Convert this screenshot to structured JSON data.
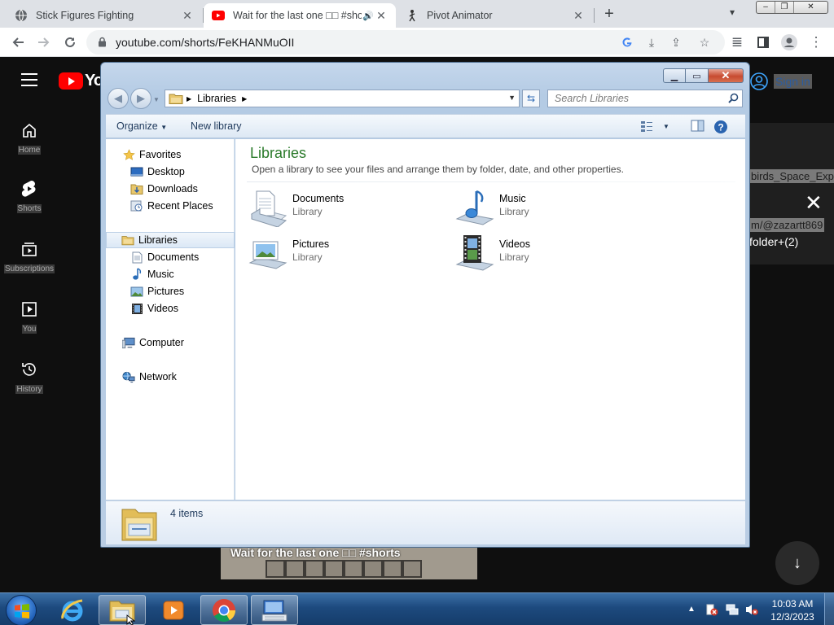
{
  "browser": {
    "tabs": [
      {
        "title": "Stick Figures Fighting",
        "active": false
      },
      {
        "title": "Wait for the last one □□ #shorts",
        "active": true,
        "audio": true
      },
      {
        "title": "Pivot Animator",
        "active": false
      }
    ],
    "url": "youtube.com/shorts/FeKHANMuOII"
  },
  "youtube": {
    "logo": "Yo",
    "nav": [
      {
        "label": "Home",
        "icon": "home-icon"
      },
      {
        "label": "Shorts",
        "icon": "shorts-icon"
      },
      {
        "label": "Subscriptions",
        "icon": "subscriptions-icon"
      },
      {
        "label": "You",
        "icon": "you-icon"
      },
      {
        "label": "History",
        "icon": "history-icon"
      }
    ],
    "sign_in": "Sign in",
    "panel_text_1": "birds_Space_Exp",
    "panel_text_2": "m/@zazartt869",
    "panel_text_3": "folder+(2)",
    "video_title": "Wait for the last one □□ #shorts"
  },
  "explorer": {
    "breadcrumb": "Libraries",
    "search_placeholder": "Search Libraries",
    "commands": {
      "organize": "Organize",
      "new_library": "New library"
    },
    "nav": {
      "favorites": "Favorites",
      "favorites_items": [
        "Desktop",
        "Downloads",
        "Recent Places"
      ],
      "libraries": "Libraries",
      "libraries_items": [
        "Documents",
        "Music",
        "Pictures",
        "Videos"
      ],
      "computer": "Computer",
      "network": "Network"
    },
    "title": "Libraries",
    "subtitle": "Open a library to see your files and arrange them by folder, date, and other properties.",
    "items": [
      {
        "name": "Documents",
        "type": "Library",
        "icon": "documents-library-icon"
      },
      {
        "name": "Music",
        "type": "Library",
        "icon": "music-library-icon"
      },
      {
        "name": "Pictures",
        "type": "Library",
        "icon": "pictures-library-icon"
      },
      {
        "name": "Videos",
        "type": "Library",
        "icon": "videos-library-icon"
      }
    ],
    "item_count": "4 items"
  },
  "taskbar": {
    "time": "10:03 AM",
    "date": "12/3/2023",
    "apps": [
      "internet-explorer-icon",
      "windows-explorer-icon",
      "media-player-icon",
      "chrome-icon",
      "on-screen-keyboard-icon"
    ]
  },
  "colors": {
    "accent_green": "#2a7a2a",
    "youtube_red": "#ff0000",
    "taskbar_blue": "#1d4a7e"
  }
}
